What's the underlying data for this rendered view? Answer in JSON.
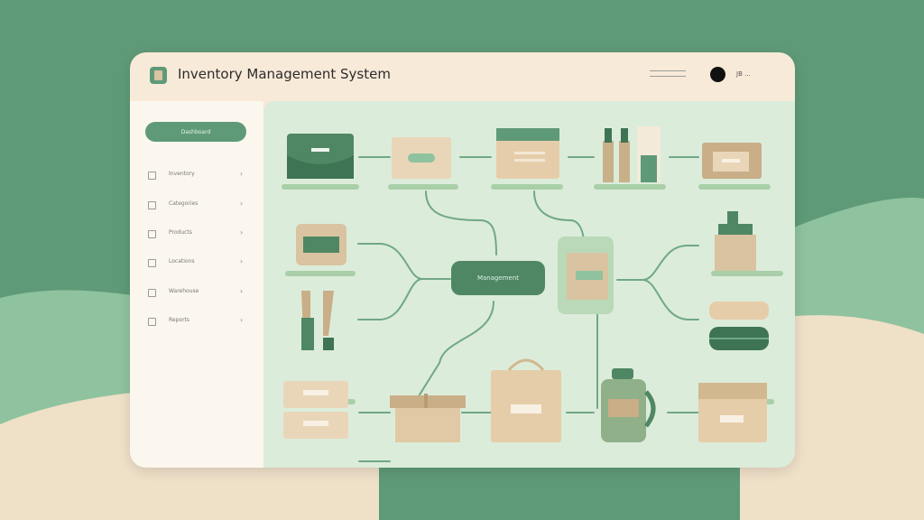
{
  "window": {
    "title": "Inventory Management System"
  },
  "header": {
    "user_label": "JB ..."
  },
  "sidebar": {
    "active_label": "Dashboard",
    "items": [
      {
        "label": "Inventory",
        "icon": "checkbox-icon"
      },
      {
        "label": "Categories",
        "icon": "checkbox-icon"
      },
      {
        "label": "Products",
        "icon": "checkbox-icon"
      },
      {
        "label": "Locations",
        "icon": "checkbox-icon"
      },
      {
        "label": "Warehouse",
        "icon": "checkbox-icon"
      },
      {
        "label": "Reports",
        "icon": "checkbox-icon"
      }
    ]
  },
  "diagram": {
    "center_label": "Management"
  },
  "colors": {
    "accent": "#5f9a78",
    "dark_green": "#4f8764",
    "panel": "#dcecda",
    "beige": "#d9c3a1",
    "window_bg": "#f8ead8"
  }
}
